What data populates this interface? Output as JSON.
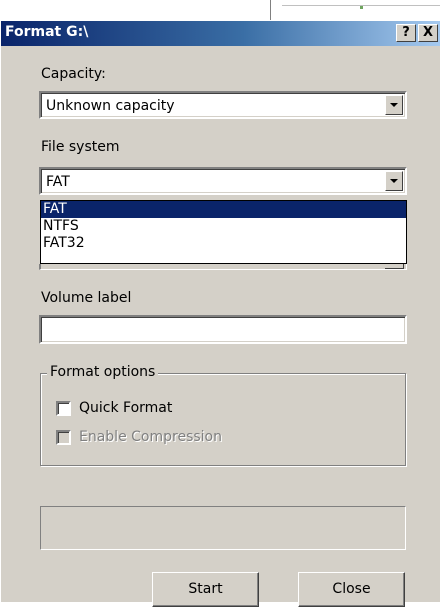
{
  "window": {
    "title": "Format G:\\"
  },
  "titlebar": {
    "help": "?",
    "close": "X"
  },
  "capacity": {
    "label": "Capacity:",
    "value": "Unknown capacity"
  },
  "file_system": {
    "label": "File system",
    "value": "FAT",
    "options": [
      "FAT",
      "NTFS",
      "FAT32"
    ],
    "highlighted": "FAT"
  },
  "volume_label": {
    "label": "Volume label",
    "value": ""
  },
  "format_options": {
    "legend": "Format options",
    "quick_format": {
      "label": "Quick Format",
      "checked": false,
      "enabled": true
    },
    "enable_compression": {
      "label": "Enable Compression",
      "checked": false,
      "enabled": false
    }
  },
  "buttons": {
    "start": "Start",
    "close": "Close"
  },
  "colors": {
    "dialog_bg": "#d4d0c8",
    "title_start": "#0a246a",
    "selection": "#0a246a"
  }
}
